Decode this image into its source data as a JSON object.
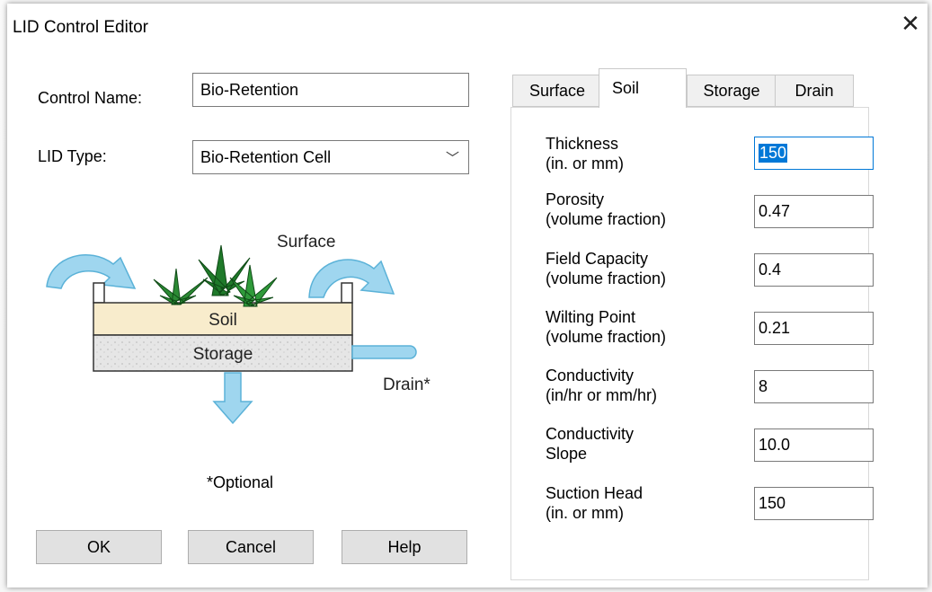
{
  "window": {
    "title": "LID Control Editor"
  },
  "form": {
    "control_name_label": "Control Name:",
    "control_name_value": "Bio-Retention",
    "lid_type_label": "LID Type:",
    "lid_type_value": "Bio-Retention Cell"
  },
  "diagram": {
    "surface": "Surface",
    "soil": "Soil",
    "storage": "Storage",
    "drain": "Drain*",
    "optional": "*Optional"
  },
  "buttons": {
    "ok": "OK",
    "cancel": "Cancel",
    "help": "Help"
  },
  "tabs": [
    {
      "label": "Surface",
      "active": false
    },
    {
      "label": "Soil",
      "active": true
    },
    {
      "label": "Storage",
      "active": false
    },
    {
      "label": "Drain",
      "active": false
    }
  ],
  "soil": {
    "params": [
      {
        "line1": "Thickness",
        "line2": "(in. or mm)",
        "value": "150"
      },
      {
        "line1": "Porosity",
        "line2": "(volume fraction)",
        "value": "0.47"
      },
      {
        "line1": "Field Capacity",
        "line2": "(volume fraction)",
        "value": "0.4"
      },
      {
        "line1": "Wilting Point",
        "line2": "(volume fraction)",
        "value": "0.21"
      },
      {
        "line1": "Conductivity",
        "line2": "(in/hr or mm/hr)",
        "value": "8"
      },
      {
        "line1": "Conductivity",
        "line2": "Slope",
        "value": "10.0"
      },
      {
        "line1": "Suction Head",
        "line2": "(in. or mm)",
        "value": "150"
      }
    ]
  },
  "colors": {
    "selection": "#0078d7",
    "arrow": "#8fd0ec",
    "soil_fill": "#f8eccc",
    "storage_fill": "#e4e4e4",
    "plant": "#1f7a2a"
  }
}
